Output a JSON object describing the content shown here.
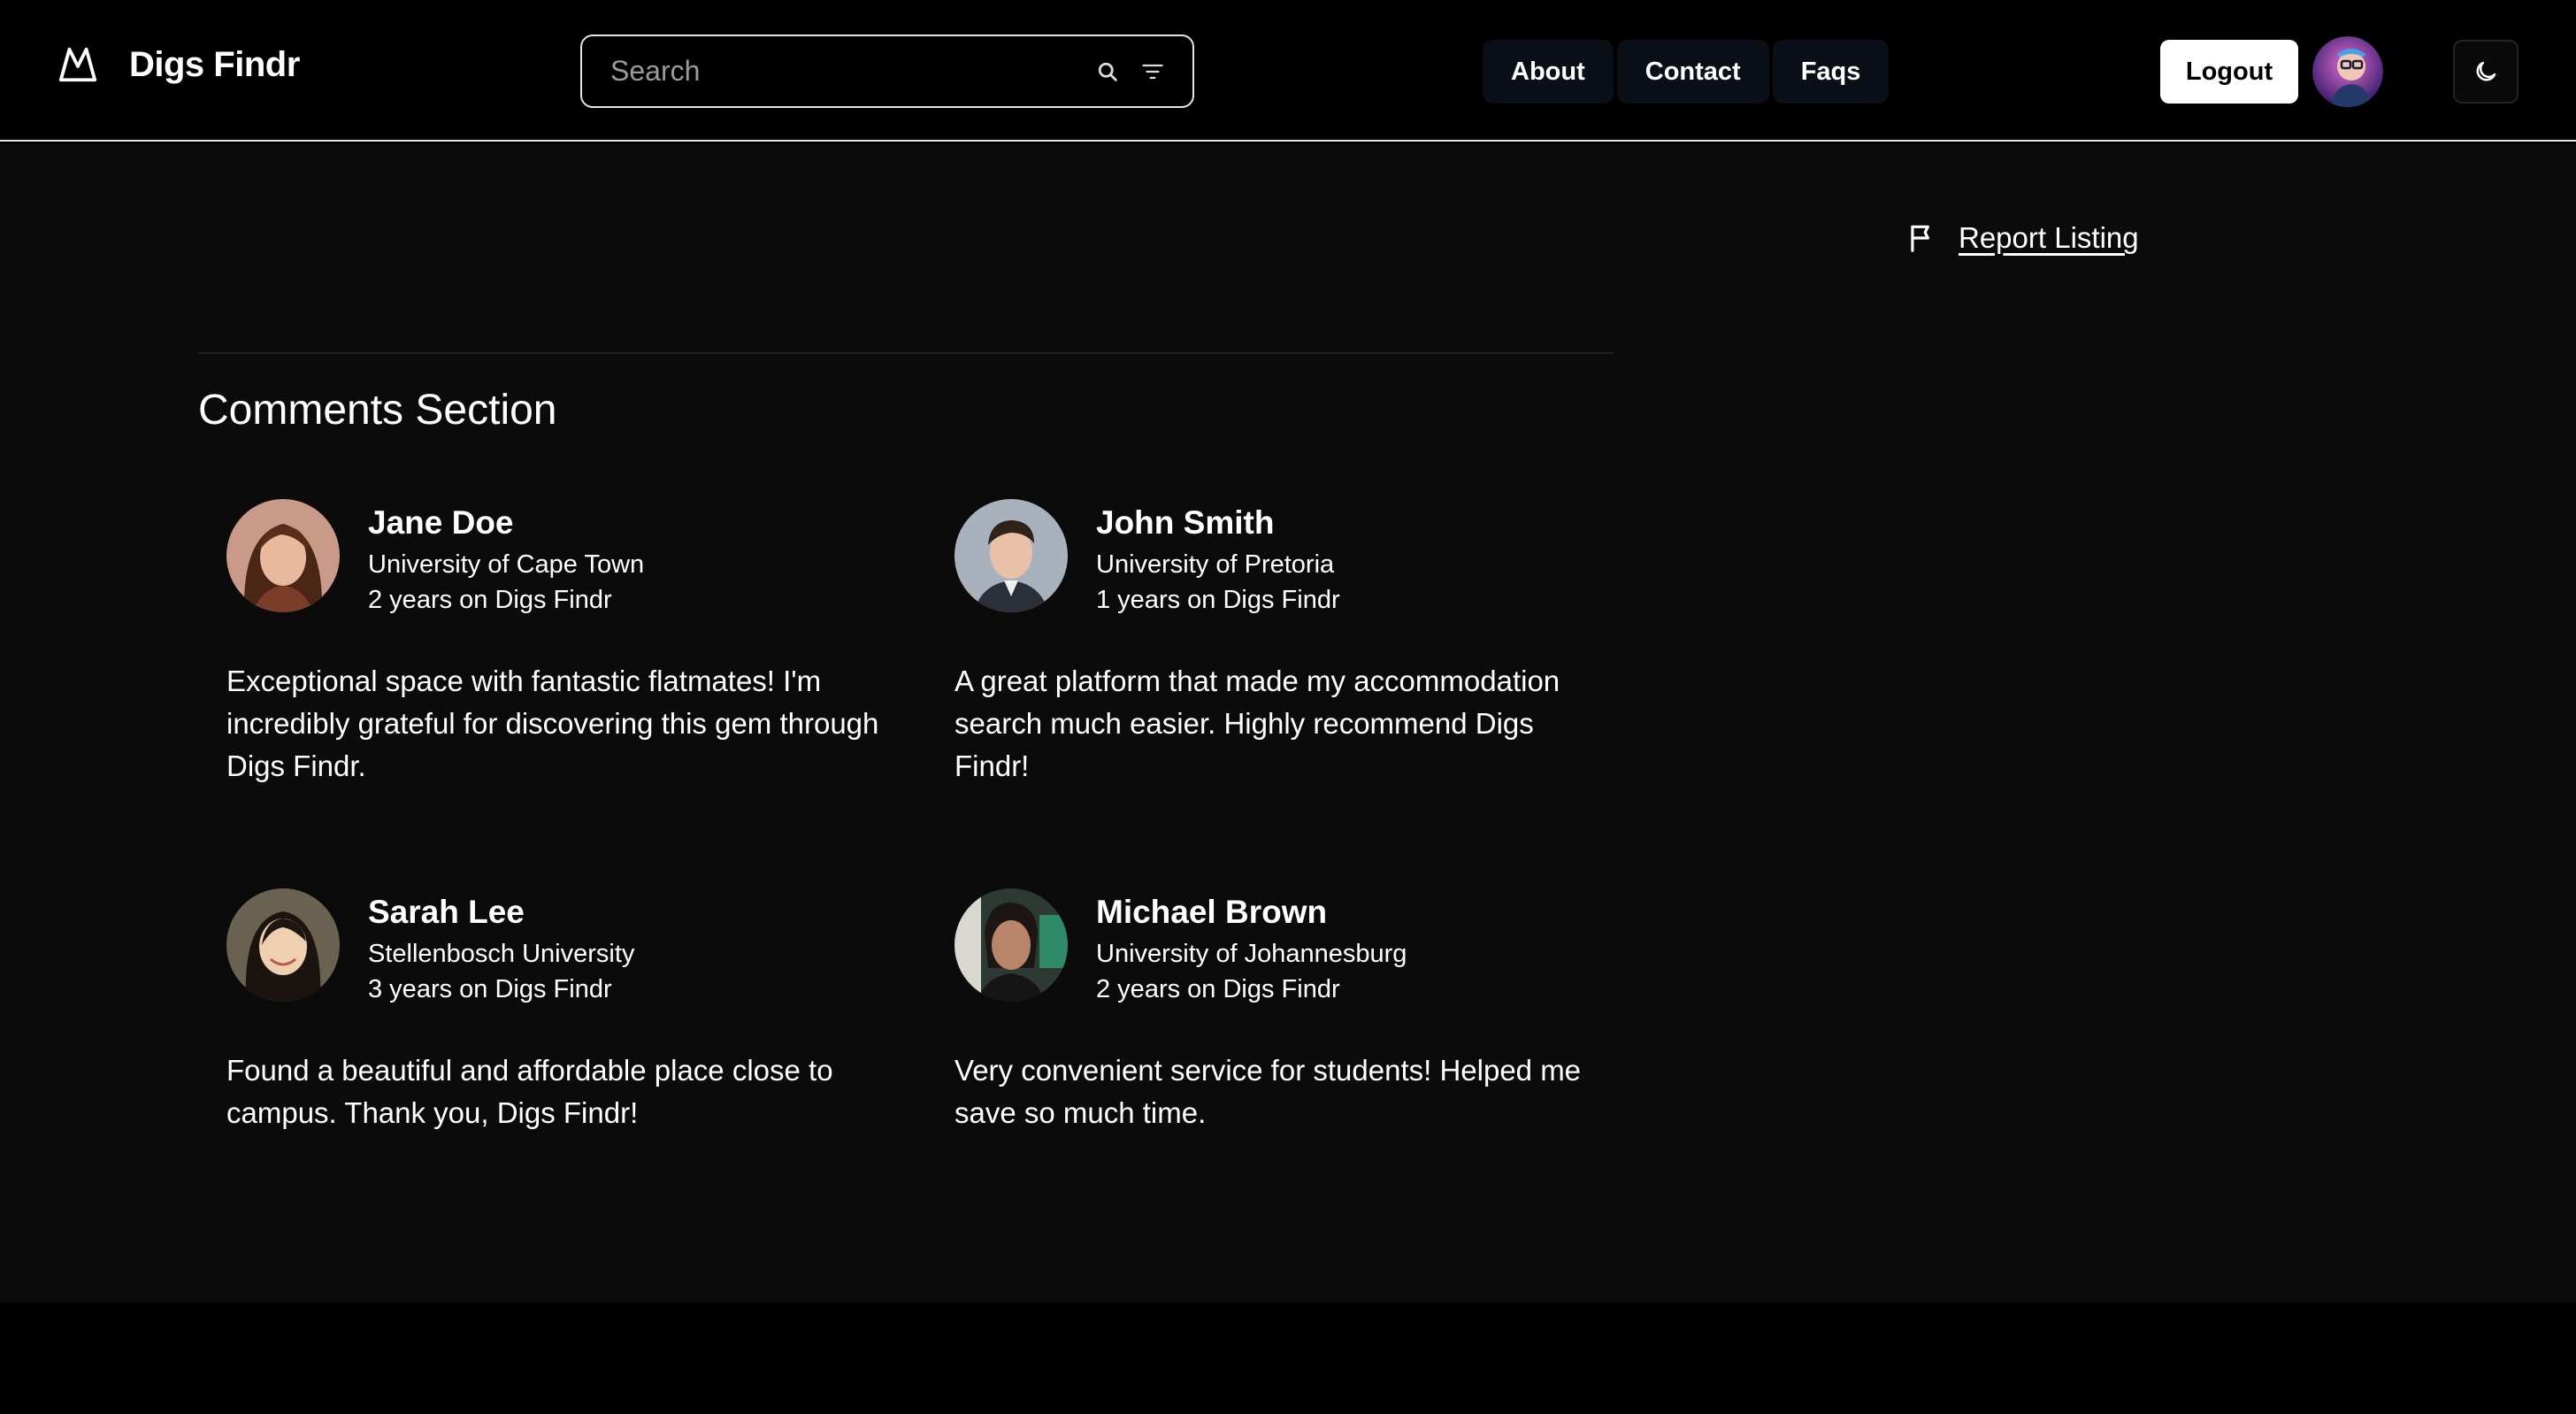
{
  "header": {
    "app_name": "Digs Findr",
    "search_placeholder": "Search",
    "nav": [
      "About",
      "Contact",
      "Faqs"
    ],
    "logout_label": "Logout"
  },
  "report_label": "Report Listing",
  "section_title": "Comments Section",
  "comments": [
    {
      "name": "Jane Doe",
      "university": "University of Cape Town",
      "tenure": "2 years on Digs Findr",
      "text": "Exceptional space with fantastic flatmates! I'm incredibly grateful for discovering this gem through Digs Findr."
    },
    {
      "name": "John Smith",
      "university": "University of Pretoria",
      "tenure": "1 years on Digs Findr",
      "text": "A great platform that made my accommodation search much easier. Highly recommend Digs Findr!"
    },
    {
      "name": "Sarah Lee",
      "university": "Stellenbosch University",
      "tenure": "3 years on Digs Findr",
      "text": "Found a beautiful and affordable place close to campus. Thank you, Digs Findr!"
    },
    {
      "name": "Michael Brown",
      "university": "University of Johannesburg",
      "tenure": "2 years on Digs Findr",
      "text": "Very convenient service for students! Helped me save so much time."
    }
  ],
  "colors": {
    "header_bg": "#000000",
    "main_bg": "#0b0b0b",
    "nav_bg": "#0b0f17",
    "text": "#ffffff"
  },
  "icons": [
    "mountain-logo-icon",
    "search-icon",
    "filter-icon",
    "moon-icon",
    "flag-icon"
  ]
}
